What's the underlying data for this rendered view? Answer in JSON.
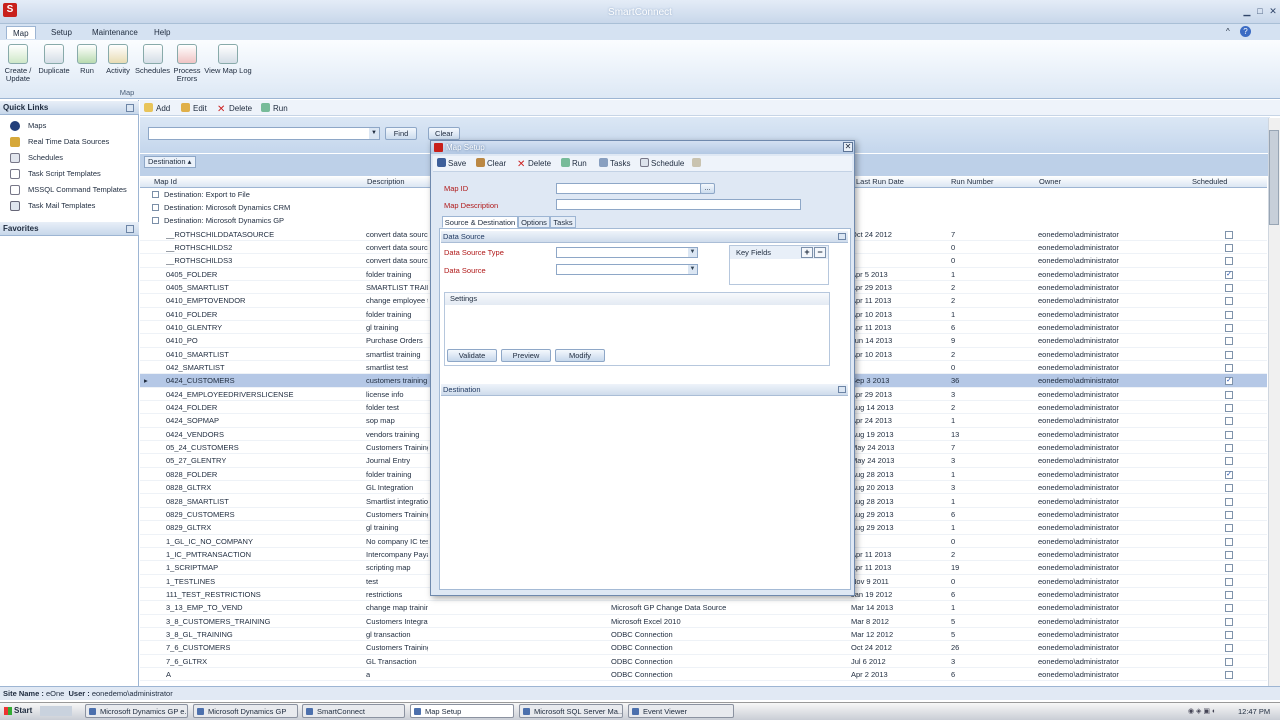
{
  "app": {
    "title": "SmartConnect",
    "logo": "S",
    "window_buttons": [
      "▁",
      "□",
      "✕"
    ],
    "ribbon_minimize": "^",
    "help": "?"
  },
  "menu": [
    "Map",
    "Setup",
    "Maintenance",
    "Help"
  ],
  "ribbon": {
    "buttons": [
      {
        "label": "Create / Update",
        "icon": "create-update-icon"
      },
      {
        "label": "Duplicate",
        "icon": "duplicate-icon"
      },
      {
        "label": "Run",
        "icon": "run-icon"
      },
      {
        "label": "Activity",
        "icon": "activity-icon"
      },
      {
        "label": "Schedules",
        "icon": "schedules-icon"
      },
      {
        "label": "Process Errors",
        "icon": "process-errors-icon"
      },
      {
        "label": "View Map Log",
        "icon": "view-map-log-icon"
      }
    ],
    "group_label": "Map"
  },
  "quick_links": {
    "title": "Quick Links",
    "items": [
      "Maps",
      "Real Time Data Sources",
      "Schedules",
      "Task Script Templates",
      "MSSQL Command Templates",
      "Task Mail Templates"
    ]
  },
  "favorites": {
    "title": "Favorites"
  },
  "toolbar": {
    "add": "Add",
    "edit": "Edit",
    "delete": "Delete",
    "run": "Run"
  },
  "filter": {
    "find": "Find",
    "clear": "Clear",
    "value": ""
  },
  "group_by": "Destination",
  "columns": [
    "Map Id",
    "Description",
    "Last Run Date",
    "Run Number",
    "Owner",
    "Scheduled"
  ],
  "groups": [
    "Destination: Export to File",
    "Destination: Microsoft Dynamics CRM",
    "Destination: Microsoft Dynamics GP"
  ],
  "rows": [
    {
      "id": "__ROTHSCHILDDATASOURCE",
      "desc": "convert data source",
      "src": "",
      "date": "Oct 24 2012",
      "run": "7",
      "owner": "eonedemo\\administrator",
      "sched": false
    },
    {
      "id": "__ROTHSCHILDS2",
      "desc": "convert data source",
      "src": "",
      "date": "",
      "run": "0",
      "owner": "eonedemo\\administrator",
      "sched": false
    },
    {
      "id": "__ROTHSCHILDS3",
      "desc": "convert data source",
      "src": "",
      "date": "",
      "run": "0",
      "owner": "eonedemo\\administrator",
      "sched": false
    },
    {
      "id": "0405_FOLDER",
      "desc": "folder training",
      "src": "",
      "date": "Apr 5 2013",
      "run": "1",
      "owner": "eonedemo\\administrator",
      "sched": true
    },
    {
      "id": "0405_SMARTLIST",
      "desc": "SMARTLIST TRAINING",
      "src": "",
      "date": "Apr 29 2013",
      "run": "2",
      "owner": "eonedemo\\administrator",
      "sched": false
    },
    {
      "id": "0410_EMPTOVENDOR",
      "desc": "change employee to",
      "src": "",
      "date": "Apr 11 2013",
      "run": "2",
      "owner": "eonedemo\\administrator",
      "sched": false
    },
    {
      "id": "0410_FOLDER",
      "desc": "folder training",
      "src": "",
      "date": "Apr 10 2013",
      "run": "1",
      "owner": "eonedemo\\administrator",
      "sched": false
    },
    {
      "id": "0410_GLENTRY",
      "desc": "gl training",
      "src": "",
      "date": "Apr 11 2013",
      "run": "6",
      "owner": "eonedemo\\administrator",
      "sched": false
    },
    {
      "id": "0410_PO",
      "desc": "Purchase Orders",
      "src": "",
      "date": "Jun 14 2013",
      "run": "9",
      "owner": "eonedemo\\administrator",
      "sched": false
    },
    {
      "id": "0410_SMARTLIST",
      "desc": "smartlist training",
      "src": "",
      "date": "Apr 10 2013",
      "run": "2",
      "owner": "eonedemo\\administrator",
      "sched": false
    },
    {
      "id": "042_SMARTLIST",
      "desc": "smartlist test",
      "src": "",
      "date": "",
      "run": "0",
      "owner": "eonedemo\\administrator",
      "sched": false
    },
    {
      "id": "0424_CUSTOMERS",
      "desc": "customers training",
      "src": "",
      "date": "Sep 3 2013",
      "run": "36",
      "owner": "eonedemo\\administrator",
      "sched": true,
      "selected": true
    },
    {
      "id": "0424_EMPLOYEEDRIVERSLICENSE",
      "desc": "license info",
      "src": "",
      "date": "Apr 29 2013",
      "run": "3",
      "owner": "eonedemo\\administrator",
      "sched": false
    },
    {
      "id": "0424_FOLDER",
      "desc": "folder test",
      "src": "",
      "date": "Aug 14 2013",
      "run": "2",
      "owner": "eonedemo\\administrator",
      "sched": false
    },
    {
      "id": "0424_SOPMAP",
      "desc": "sop map",
      "src": "",
      "date": "Apr 24 2013",
      "run": "1",
      "owner": "eonedemo\\administrator",
      "sched": false
    },
    {
      "id": "0424_VENDORS",
      "desc": "vendors training",
      "src": "",
      "date": "Aug 19 2013",
      "run": "13",
      "owner": "eonedemo\\administrator",
      "sched": false
    },
    {
      "id": "05_24_CUSTOMERS",
      "desc": "Customers Training",
      "src": "",
      "date": "May 24 2013",
      "run": "7",
      "owner": "eonedemo\\administrator",
      "sched": false
    },
    {
      "id": "05_27_GLENTRY",
      "desc": "Journal Entry",
      "src": "",
      "date": "May 24 2013",
      "run": "3",
      "owner": "eonedemo\\administrator",
      "sched": false
    },
    {
      "id": "0828_FOLDER",
      "desc": "folder training",
      "src": "",
      "date": "Aug 28 2013",
      "run": "1",
      "owner": "eonedemo\\administrator",
      "sched": true
    },
    {
      "id": "0828_GLTRX",
      "desc": "GL Integration",
      "src": "",
      "date": "Aug 20 2013",
      "run": "3",
      "owner": "eonedemo\\administrator",
      "sched": false
    },
    {
      "id": "0828_SMARTLIST",
      "desc": "Smartlist integration",
      "src": "",
      "date": "Aug 28 2013",
      "run": "1",
      "owner": "eonedemo\\administrator",
      "sched": false
    },
    {
      "id": "0829_CUSTOMERS",
      "desc": "Customers Training",
      "src": "",
      "date": "Aug 29 2013",
      "run": "6",
      "owner": "eonedemo\\administrator",
      "sched": false
    },
    {
      "id": "0829_GLTRX",
      "desc": "gl training",
      "src": "",
      "date": "Aug 29 2013",
      "run": "1",
      "owner": "eonedemo\\administrator",
      "sched": false
    },
    {
      "id": "1_GL_IC_NO_COMPANY",
      "desc": "No company IC test",
      "src": "",
      "date": "",
      "run": "0",
      "owner": "eonedemo\\administrator",
      "sched": false
    },
    {
      "id": "1_IC_PMTRANSACTION",
      "desc": "Intercompany Payables",
      "src": "",
      "date": "Apr 11 2013",
      "run": "2",
      "owner": "eonedemo\\administrator",
      "sched": false
    },
    {
      "id": "1_SCRIPTMAP",
      "desc": "scripting map",
      "src": "",
      "date": "Apr 11 2013",
      "run": "19",
      "owner": "eonedemo\\administrator",
      "sched": false
    },
    {
      "id": "1_TESTLINES",
      "desc": "test",
      "src": "",
      "date": "Nov 9 2011",
      "run": "0",
      "owner": "eonedemo\\administrator",
      "sched": false
    },
    {
      "id": "111_TEST_RESTRICTIONS",
      "desc": "restrictions",
      "src": "",
      "date": "Jan 19 2012",
      "run": "6",
      "owner": "eonedemo\\administrator",
      "sched": false
    },
    {
      "id": "3_13_EMP_TO_VEND",
      "desc": "change map training",
      "src": "Microsoft GP Change Data Source",
      "date": "Mar 14 2013",
      "run": "1",
      "owner": "eonedemo\\administrator",
      "sched": false
    },
    {
      "id": "3_8_CUSTOMERS_TRAINING",
      "desc": "Customers Integration",
      "src": "Microsoft Excel 2010",
      "date": "Mar 8 2012",
      "run": "5",
      "owner": "eonedemo\\administrator",
      "sched": false
    },
    {
      "id": "3_8_GL_TRAINING",
      "desc": "gl transaction",
      "src": "ODBC Connection",
      "date": "Mar 12 2012",
      "run": "5",
      "owner": "eonedemo\\administrator",
      "sched": false
    },
    {
      "id": "7_6_CUSTOMERS",
      "desc": "Customers Training",
      "src": "ODBC Connection",
      "date": "Oct 24 2012",
      "run": "26",
      "owner": "eonedemo\\administrator",
      "sched": false
    },
    {
      "id": "7_6_GLTRX",
      "desc": "GL Transaction",
      "src": "ODBC Connection",
      "date": "Jul 6 2012",
      "run": "3",
      "owner": "eonedemo\\administrator",
      "sched": false
    },
    {
      "id": "A",
      "desc": "a",
      "src": "ODBC Connection",
      "date": "Apr 2 2013",
      "run": "6",
      "owner": "eonedemo\\administrator",
      "sched": false
    }
  ],
  "dialog": {
    "title": "Map Setup",
    "close": "✕",
    "toolbar": {
      "save": "Save",
      "clear": "Clear",
      "delete": "Delete",
      "run": "Run",
      "tasks": "Tasks",
      "schedule": "Schedule"
    },
    "map_id_label": "Map ID",
    "map_id_value": "",
    "map_desc_label": "Map Description",
    "map_desc_value": "",
    "lookup": "...",
    "tabs": [
      "Source & Destination",
      "Options",
      "Tasks"
    ],
    "data_source_section": "Data Source",
    "data_source_type_label": "Data Source Type",
    "data_source_label": "Data Source",
    "key_fields": "Key Fields",
    "settings": "Settings",
    "validate": "Validate",
    "preview": "Preview",
    "modify": "Modify",
    "destination_section": "Destination"
  },
  "status": {
    "site_label": "Site Name :",
    "site": "eOne",
    "user_label": "User :",
    "user": "eonedemo\\administrator"
  },
  "taskbar": {
    "start": "Start",
    "items": [
      "Microsoft Dynamics GP e...",
      "Microsoft Dynamics GP",
      "SmartConnect",
      "Map Setup",
      "Microsoft SQL Server Ma...",
      "Event Viewer"
    ],
    "clock": "12:47 PM"
  },
  "colors": {
    "accent": "#c8201b",
    "ribbon": "#d5e2f2",
    "selection": "#b5c8e6",
    "label_red": "#b01818"
  }
}
